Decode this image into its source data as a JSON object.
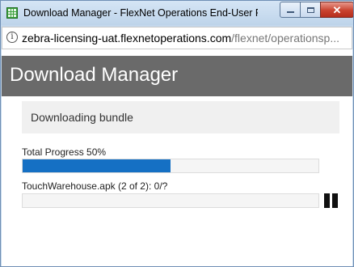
{
  "window": {
    "title": "Download Manager - FlexNet Operations End-User Port...",
    "app_icon": "grid-app-icon",
    "controls": {
      "minimize_icon": "minimize-icon",
      "maximize_icon": "maximize-icon",
      "close_icon": "close-icon",
      "close_glyph": "✕"
    }
  },
  "address_bar": {
    "info_glyph": "i",
    "url_host": "zebra-licensing-uat.flexnetoperations.com",
    "url_path": "/flexnet/operationsp..."
  },
  "page": {
    "header_title": "Download Manager",
    "status_text": "Downloading bundle",
    "total_progress": {
      "label": "Total Progress 50%",
      "value_percent": 50,
      "color": "#1570c4"
    },
    "file_progress": {
      "label": "TouchWarehouse.apk (2 of 2): 0/?",
      "value_percent": 0
    },
    "pause_icon": "pause-icon"
  },
  "colors": {
    "header_bg": "#6a6a6a",
    "progress_fill": "#1570c4",
    "close_button": "#c9432f"
  }
}
